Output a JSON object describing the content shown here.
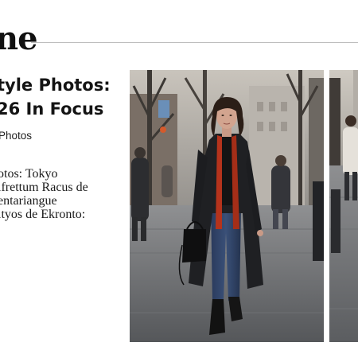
{
  "masthead": {
    "title_fragment": "ne"
  },
  "article": {
    "headline_lines": [
      "tyle Photos:",
      "26 In Focus"
    ],
    "category": "Photos",
    "excerpt_lines": [
      "otos: Tokyo",
      "ifrettum Racus de",
      "entariangue",
      "ityos de Ekronto:"
    ]
  },
  "gallery": {
    "main_photo_icon": "street-style-photo",
    "side_photo_icon": "street-style-photo"
  },
  "colors": {
    "background": "#ffffff",
    "text": "#111111",
    "rule": "#bdbdbd",
    "coat": "#1f2023",
    "scarf": "#b5331c",
    "jeans": "#2d3e60"
  }
}
